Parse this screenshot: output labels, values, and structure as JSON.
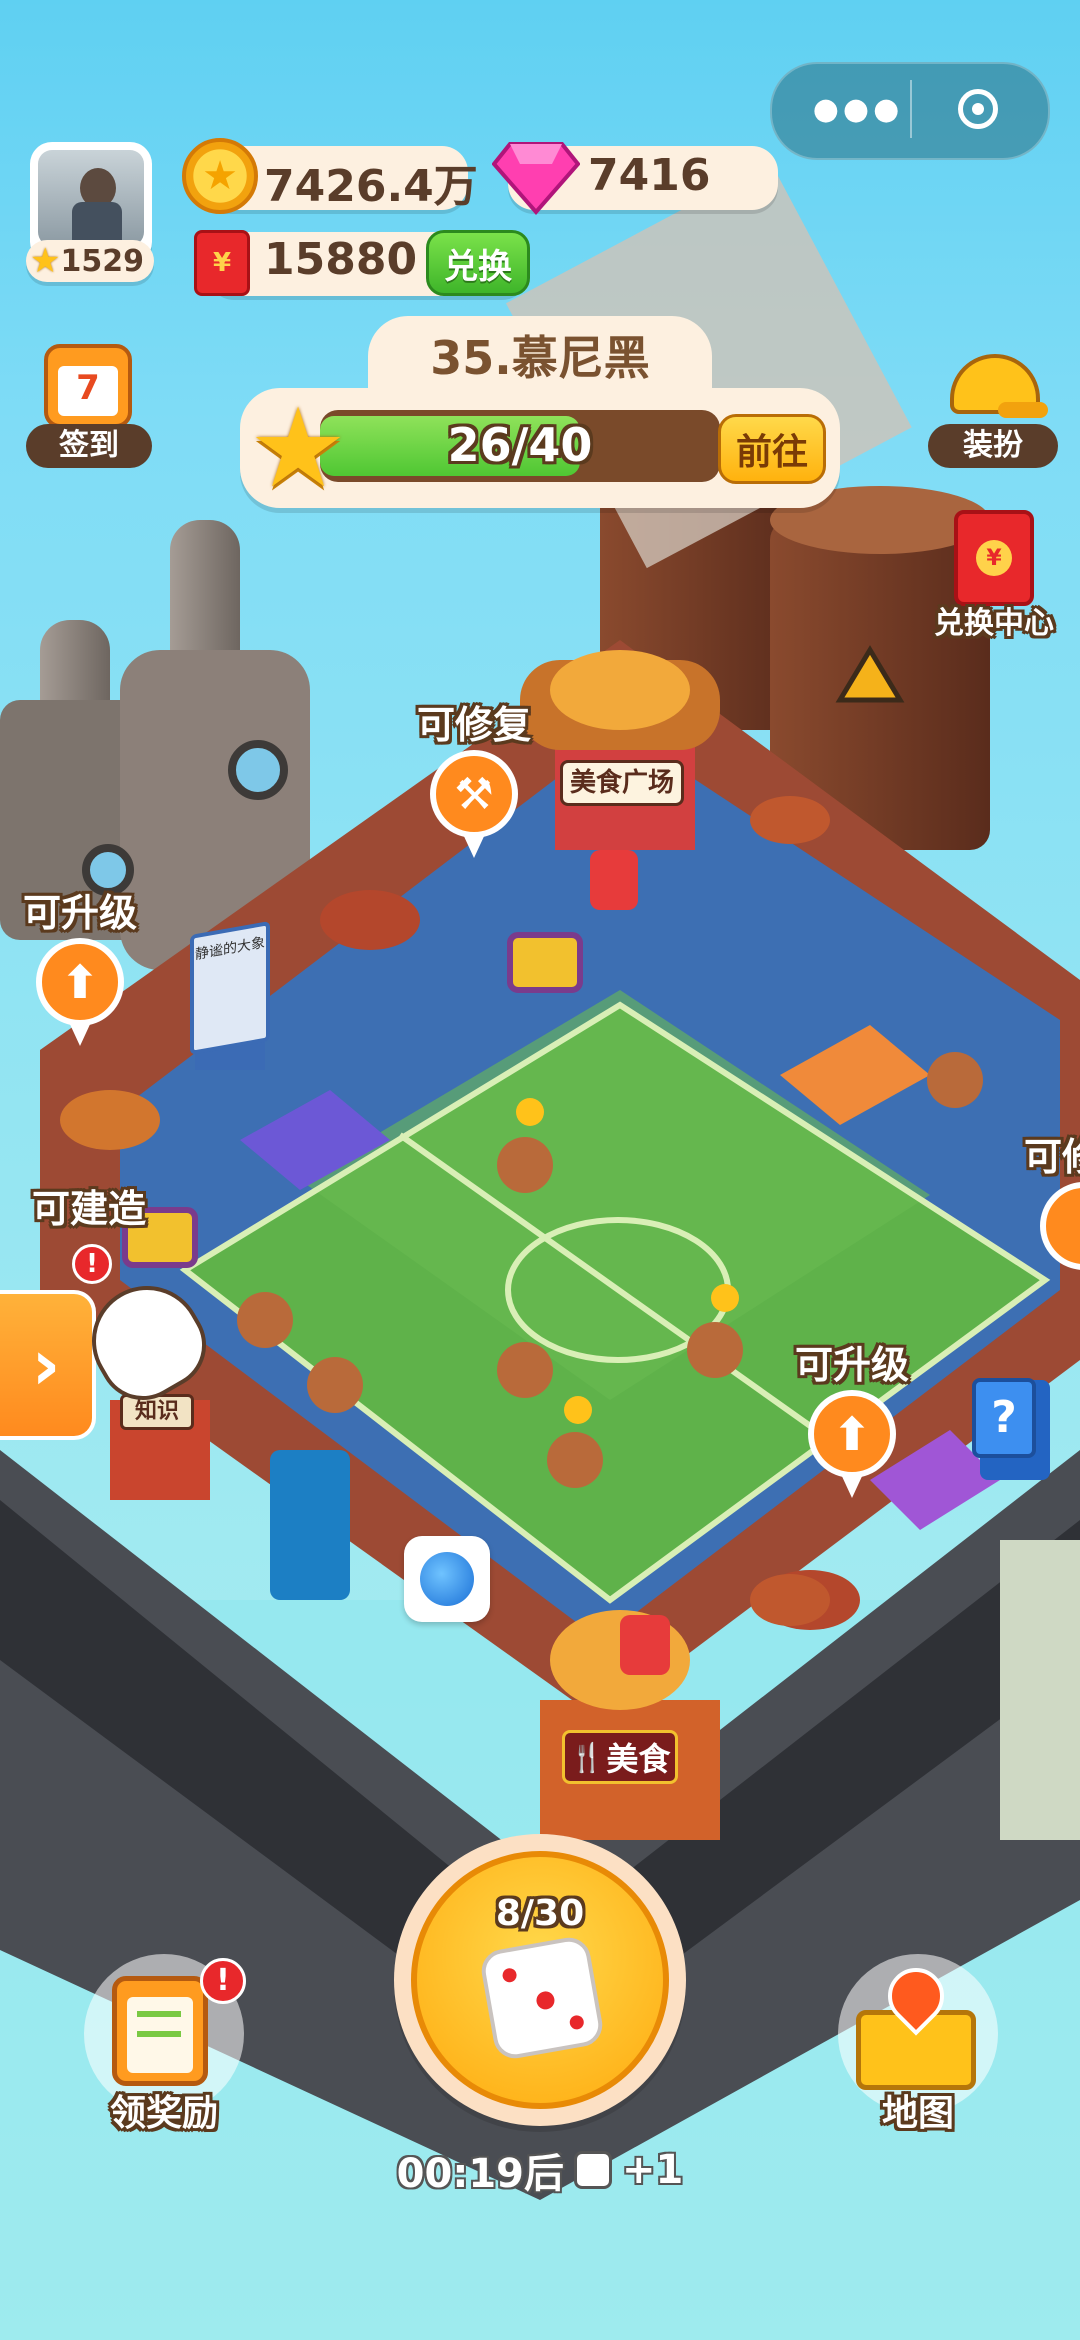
{
  "header": {
    "level": "1529",
    "coins": "7426.4万",
    "gems": "7416",
    "redpacket": "15880",
    "exchange_label": "兑换"
  },
  "side_left": {
    "checkin_day": "7",
    "checkin_label": "签到"
  },
  "side_right": {
    "dress_label": "装扮",
    "exchange_center_label": "兑换中心"
  },
  "stage": {
    "title": "35.慕尼黑",
    "progress_text": "26/40",
    "progress_value": 26,
    "progress_max": 40,
    "go_label": "前往"
  },
  "board": {
    "repair_label": "可修复",
    "upgrade_left_label": "可升级",
    "build_label": "可建造",
    "upgrade_right_label": "可升级",
    "repair_right_label": "可修",
    "food_plaza_sign": "美食广场",
    "food_sign": "美食",
    "billboard_text": "静谧的大象",
    "knowledge_sign": "知识"
  },
  "bottom": {
    "dice_count": "8/30",
    "reward_label": "领奖励",
    "map_label": "地图",
    "timer_text": "00:19后",
    "timer_bonus": "+1"
  },
  "colors": {
    "accent": "#ffc21a",
    "progress": "#4fc733",
    "sky": "#6fd6f4"
  }
}
